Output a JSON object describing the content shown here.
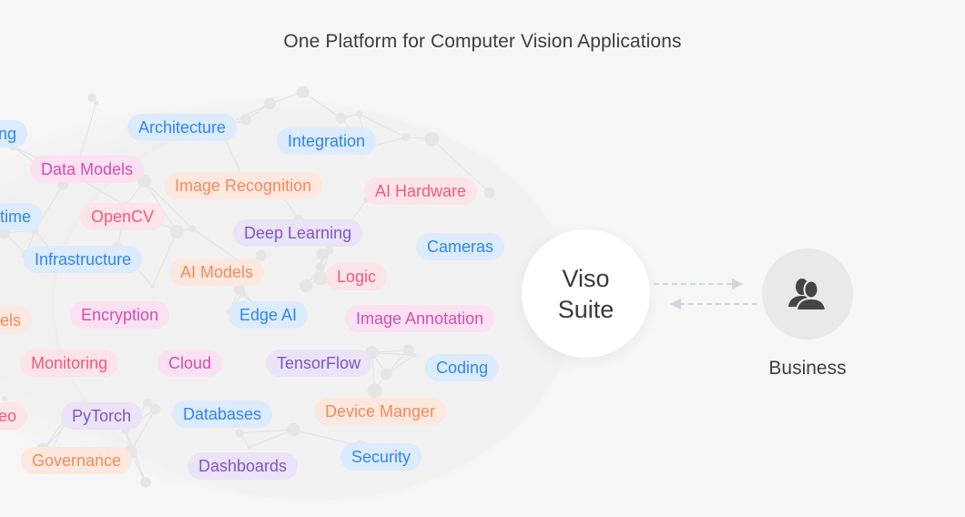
{
  "title": "One Platform for Computer Vision Applications",
  "center_node": {
    "line1": "Viso",
    "line2": "Suite"
  },
  "business_node": {
    "label": "Business",
    "icon": "users-icon"
  },
  "connector": {
    "arrow_color": "#cfd8e0",
    "directions": [
      "to-business",
      "to-viso-suite"
    ]
  },
  "palette": {
    "blue": {
      "bg": "#dcebfd",
      "fg": "#2f86f0"
    },
    "pink": {
      "bg": "#fbe1f2",
      "fg": "#d34eab"
    },
    "orange": {
      "bg": "#fde8df",
      "fg": "#f48a5a"
    },
    "red": {
      "bg": "#fde3ea",
      "fg": "#f05a7e"
    },
    "purple": {
      "bg": "#ebe3f7",
      "fg": "#7f55c4"
    }
  },
  "tags": [
    {
      "label": "ing",
      "color": "blue"
    },
    {
      "label": "Architecture",
      "color": "blue"
    },
    {
      "label": "Integration",
      "color": "blue"
    },
    {
      "label": "Data Models",
      "color": "pink"
    },
    {
      "label": "Image Recognition",
      "color": "orange"
    },
    {
      "label": "AI Hardware",
      "color": "red"
    },
    {
      "label": "time",
      "color": "blue"
    },
    {
      "label": "OpenCV",
      "color": "red"
    },
    {
      "label": "Deep Learning",
      "color": "purple"
    },
    {
      "label": "Cameras",
      "color": "blue"
    },
    {
      "label": "Infrastructure",
      "color": "blue"
    },
    {
      "label": "AI Models",
      "color": "orange"
    },
    {
      "label": "Logic",
      "color": "red"
    },
    {
      "label": "dels",
      "color": "orange"
    },
    {
      "label": "Encryption",
      "color": "pink"
    },
    {
      "label": "Edge AI",
      "color": "blue"
    },
    {
      "label": "Image Annotation",
      "color": "pink"
    },
    {
      "label": "Monitoring",
      "color": "red"
    },
    {
      "label": "Cloud",
      "color": "pink"
    },
    {
      "label": "TensorFlow",
      "color": "purple"
    },
    {
      "label": "Coding",
      "color": "blue"
    },
    {
      "label": "eo",
      "color": "red"
    },
    {
      "label": "PyTorch",
      "color": "purple"
    },
    {
      "label": "Databases",
      "color": "blue"
    },
    {
      "label": "Device Manger",
      "color": "orange"
    },
    {
      "label": "Governance",
      "color": "orange"
    },
    {
      "label": "Dashboards",
      "color": "purple"
    },
    {
      "label": "Security",
      "color": "blue"
    }
  ]
}
